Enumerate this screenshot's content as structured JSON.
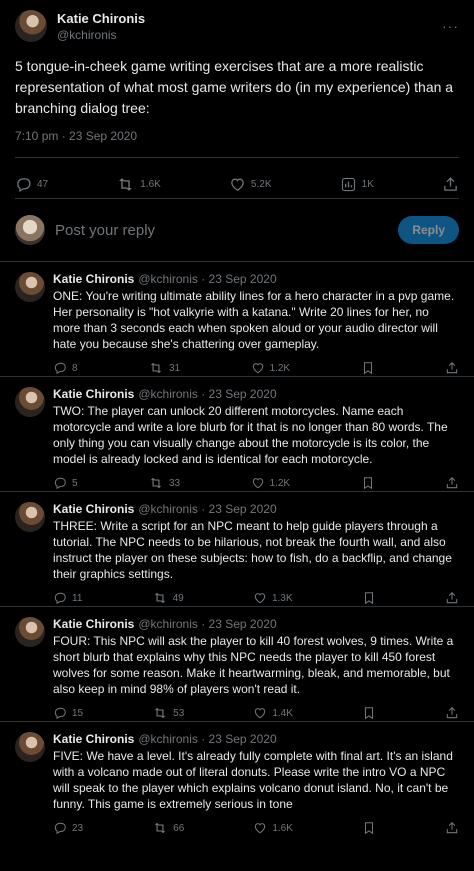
{
  "main_tweet": {
    "author_name": "Katie Chironis",
    "author_handle": "@kchironis",
    "more_glyph": "···",
    "text": "5 tongue-in-cheek game writing exercises that are a more realistic representation of what most game writers do (in my experience) than a branching dialog tree:",
    "timestamp": "7:10 pm · 23 Sep 2020",
    "stats": {
      "replies": "47",
      "retweets": "1.6K",
      "likes": "5.2K",
      "views": "1K"
    }
  },
  "composer": {
    "placeholder": "Post your reply",
    "reply_label": "Reply"
  },
  "replies": [
    {
      "name": "Katie Chironis",
      "handle_time": "@kchironis · 23 Sep 2020",
      "text": "ONE: You're writing ultimate ability lines for a hero character in a pvp game. Her personality is \"hot valkyrie with a katana.\" Write 20 lines for her, no more than 3 seconds each when spoken aloud or your audio director will hate you because she's chattering over gameplay.",
      "replies": "8",
      "retweets": "31",
      "likes": "1.2K"
    },
    {
      "name": "Katie Chironis",
      "handle_time": "@kchironis · 23 Sep 2020",
      "text": "TWO: The player can unlock 20 different motorcycles. Name each motorcycle and write a lore blurb for it that is no longer than 80 words. The only thing you can visually change about the motorcycle is its color, the model is already locked and is identical for each motorcycle.",
      "replies": "5",
      "retweets": "33",
      "likes": "1.2K"
    },
    {
      "name": "Katie Chironis",
      "handle_time": "@kchironis · 23 Sep 2020",
      "text": "THREE: Write a script for an NPC meant to help guide players through a tutorial. The NPC needs to be hilarious, not break the fourth wall, and also instruct the player on these subjects: how to fish, do a backflip, and change their graphics settings.",
      "replies": "11",
      "retweets": "49",
      "likes": "1.3K"
    },
    {
      "name": "Katie Chironis",
      "handle_time": "@kchironis · 23 Sep 2020",
      "text": "FOUR: This NPC will ask the player to kill 40 forest wolves, 9 times. Write a short blurb that explains why this NPC needs the player to kill 450 forest wolves for some reason. Make it heartwarming, bleak, and memorable, but also keep in mind 98% of players won't read it.",
      "replies": "15",
      "retweets": "53",
      "likes": "1.4K"
    },
    {
      "name": "Katie Chironis",
      "handle_time": "@kchironis · 23 Sep 2020",
      "text": "FIVE: We have a level. It's already fully complete with final art. It's an island with a volcano made out of literal donuts. Please write the intro VO a NPC will speak to the player which explains volcano donut island. No, it can't be funny. This game is extremely serious in tone",
      "replies": "23",
      "retweets": "66",
      "likes": "1.6K"
    }
  ],
  "colors": {
    "accent": "#1d9bf0",
    "muted": "#71767b",
    "text": "#e7e9ea",
    "background": "#000000"
  },
  "icons": [
    "reply-icon",
    "retweet-icon",
    "like-icon",
    "views-icon",
    "bookmark-icon",
    "share-icon"
  ]
}
